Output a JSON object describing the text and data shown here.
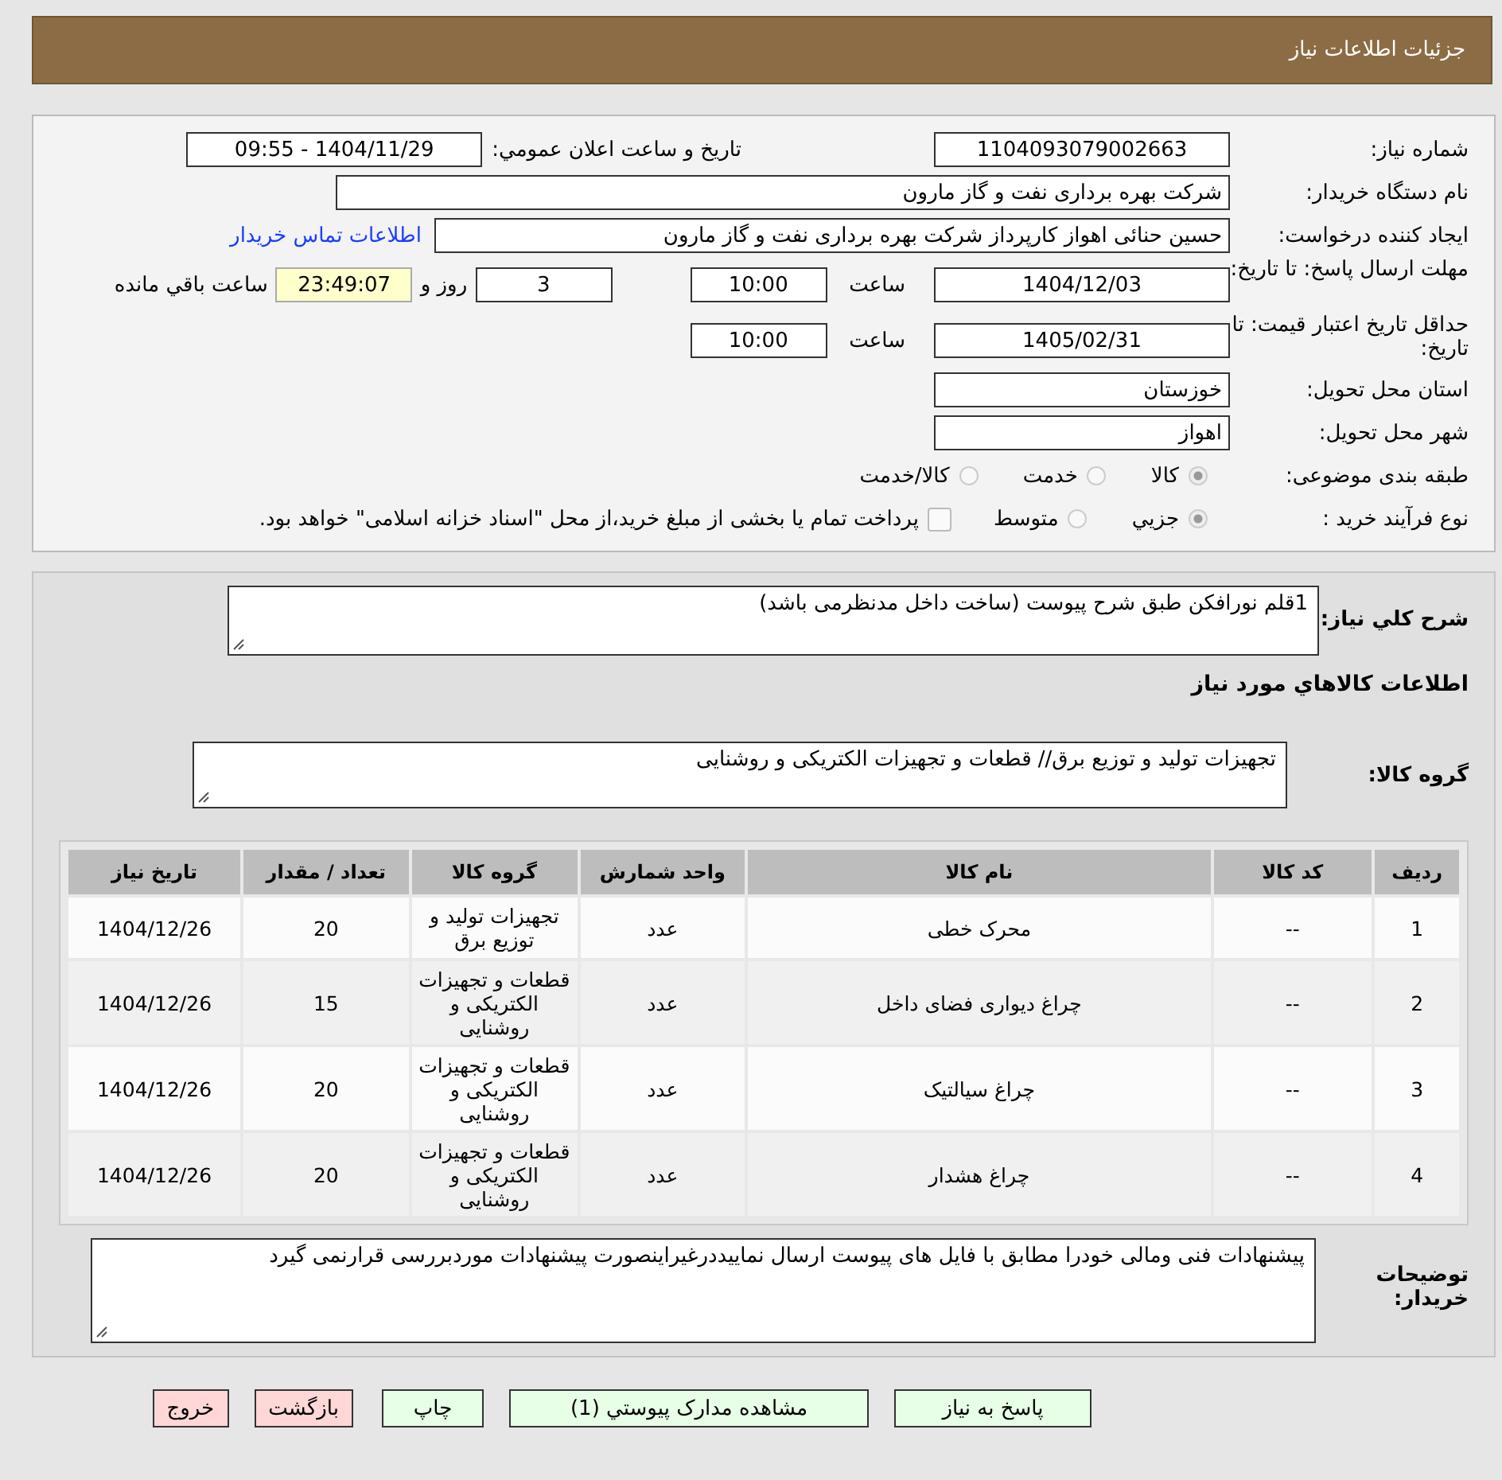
{
  "header": {
    "title": "جزئیات اطلاعات نیاز"
  },
  "need_number": {
    "label": "شماره نیاز:",
    "value": "1104093079002663"
  },
  "announce": {
    "label": "تاریخ و ساعت اعلان عمومي:",
    "value": "1404/11/29 - 09:55"
  },
  "buyer_org": {
    "label": "نام دستگاه خریدار:",
    "value": "شرکت بهره برداری نفت و گاز مارون"
  },
  "requester": {
    "label": "ایجاد کننده درخواست:",
    "value": "حسین حنائی اهواز کارپرداز شرکت بهره برداری نفت و گاز مارون",
    "contact_link": "اطلاعات تماس خریدار"
  },
  "deadline": {
    "label": "مهلت ارسال پاسخ: تا تاریخ:",
    "date": "1404/12/03",
    "time_label": "ساعت",
    "time": "10:00",
    "days": "3",
    "days_label": "روز و",
    "remaining": "23:49:07",
    "remaining_label": "ساعت باقي مانده"
  },
  "validity": {
    "label": "حداقل تاریخ اعتبار قیمت: تا تاریخ:",
    "date": "1405/02/31",
    "time_label": "ساعت",
    "time": "10:00"
  },
  "province": {
    "label": "استان محل تحویل:",
    "value": "خوزستان"
  },
  "city": {
    "label": "شهر محل تحویل:",
    "value": "اهواز"
  },
  "category": {
    "label": "طبقه بندی موضوعی:",
    "options": [
      {
        "label": "کالا",
        "selected": true
      },
      {
        "label": "خدمت",
        "selected": false
      },
      {
        "label": "کالا/خدمت",
        "selected": false
      }
    ]
  },
  "purchase_type": {
    "label": "نوع فرآیند خرید :",
    "options": [
      {
        "label": "جزيي",
        "selected": true
      },
      {
        "label": "متوسط",
        "selected": false
      }
    ],
    "payment": {
      "label": "پرداخت تمام یا بخشی از مبلغ خرید،از محل \"اسناد خزانه اسلامی\" خواهد بود.",
      "checked": false
    }
  },
  "description": {
    "label": "شرح کلي نیاز:",
    "value": "1قلم نورافکن طبق شرح پیوست (ساخت داخل مدنظرمی باشد)"
  },
  "goods_heading": "اطلاعات کالاهاي مورد نیاز",
  "goods_group": {
    "label": "گروه کالا:",
    "value": "تجهیزات تولید و توزیع برق// قطعات و تجهیزات الکتریکی و روشنایی"
  },
  "table": {
    "columns": [
      "ردیف",
      "کد کالا",
      "نام کالا",
      "واحد شمارش",
      "گروه کالا",
      "تعداد / مقدار",
      "تاریخ نیاز"
    ],
    "rows": [
      [
        "1",
        "--",
        "محرک خطی",
        "عدد",
        "تجهیزات تولید و توزیع برق",
        "20",
        "1404/12/26"
      ],
      [
        "2",
        "--",
        "چراغ دیواری فضای داخل",
        "عدد",
        "قطعات و تجهیزات الکتریکی و روشنایی",
        "15",
        "1404/12/26"
      ],
      [
        "3",
        "--",
        "چراغ سیالتیک",
        "عدد",
        "قطعات و تجهیزات الکتریکی و روشنایی",
        "20",
        "1404/12/26"
      ],
      [
        "4",
        "--",
        "چراغ هشدار",
        "عدد",
        "قطعات و تجهیزات الکتریکی و روشنایی",
        "20",
        "1404/12/26"
      ]
    ]
  },
  "buyer_notes": {
    "label": "توضیحات خریدار:",
    "value": "پیشنهادات فنی ومالی خودرا  مطابق با فایل های پیوست ارسال نماییددرغیراینصورت پیشنهادات موردبررسی قرارنمی گیرد"
  },
  "buttons": [
    {
      "label": "پاسخ به نیاز",
      "kind": "action"
    },
    {
      "label": "مشاهده مدارک پیوستي (1)",
      "kind": "action"
    },
    {
      "label": "چاپ",
      "kind": "action"
    },
    {
      "label": "بازگشت",
      "kind": "exit"
    },
    {
      "label": "خروج",
      "kind": "exit"
    }
  ]
}
